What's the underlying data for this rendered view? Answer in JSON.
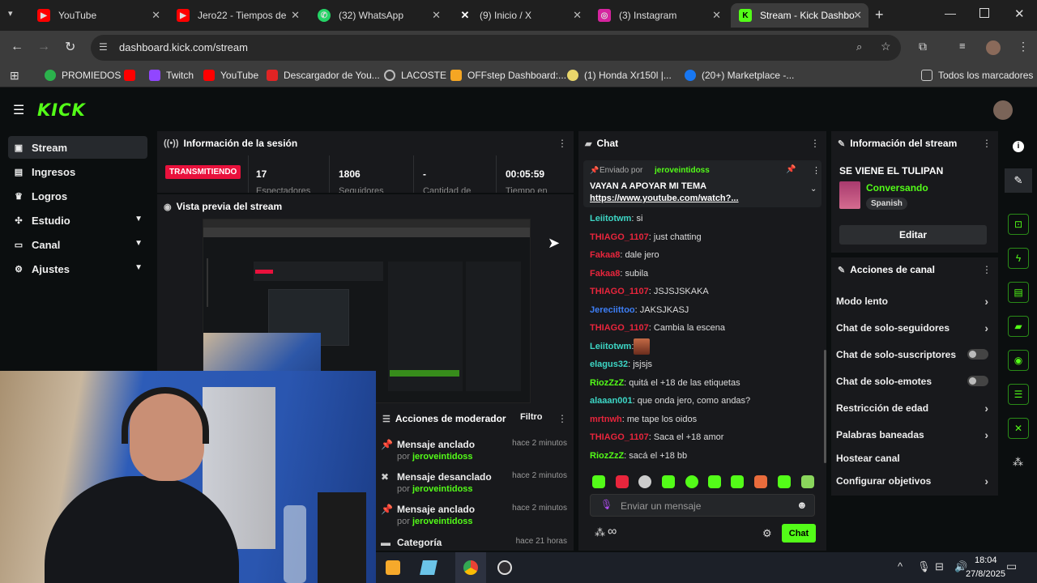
{
  "browser": {
    "tabs": [
      {
        "title": "YouTube",
        "color": "#ff0000"
      },
      {
        "title": "Jero22 - Tiempos de",
        "color": "#ff0000"
      },
      {
        "title": "(32) WhatsApp",
        "color": "#25d366"
      },
      {
        "title": "(9) Inicio / X",
        "color": "#111111"
      },
      {
        "title": "(3) Instagram",
        "color": "#d6249f"
      },
      {
        "title": "Stream - Kick Dashbo",
        "color": "#53fc18"
      }
    ],
    "url": "dashboard.kick.com/stream",
    "bookmarks": [
      {
        "label": "PROMIEDOS",
        "color": "#2bb24c"
      },
      {
        "label": "",
        "color": "#ff0000"
      },
      {
        "label": "Twitch",
        "color": "#9146ff"
      },
      {
        "label": "YouTube",
        "color": "#ff0000"
      },
      {
        "label": "Descargador de You...",
        "color": "#e02424"
      },
      {
        "label": "LACOSTE",
        "color": "#888888"
      },
      {
        "label": "OFFstep Dashboard:...",
        "color": "#f5a623"
      },
      {
        "label": "(1) Honda Xr150l |...",
        "color": "#e9d66b"
      },
      {
        "label": "(20+) Marketplace -...",
        "color": "#1877f2"
      }
    ],
    "all_bookmarks": "Todos los marcadores"
  },
  "kick": {
    "logo": "KICK",
    "sidebar": [
      "Stream",
      "Ingresos",
      "Logros",
      "Estudio",
      "Canal",
      "Ajustes"
    ],
    "session": {
      "title": "Información de la sesión",
      "status": "TRANSMITIENDO",
      "stats": [
        {
          "value": "17",
          "label": "Espectadores"
        },
        {
          "value": "1806",
          "label": "Seguidores"
        },
        {
          "value": "-",
          "label": "Cantidad de"
        },
        {
          "value": "00:05:59",
          "label": "Tiempo en"
        }
      ]
    },
    "preview_title": "Vista previa del stream",
    "moderator": {
      "title": "Acciones de moderador",
      "filter": "Filtro",
      "items": [
        {
          "action": "Mensaje anclado",
          "by": "jeroveintidoss",
          "time": "hace 2 minutos"
        },
        {
          "action": "Mensaje desanclado",
          "by": "jeroveintidoss",
          "time": "hace 2 minutos"
        },
        {
          "action": "Mensaje anclado",
          "by": "jeroveintidoss",
          "time": "hace 2 minutos"
        },
        {
          "action": "Categoría",
          "by": "",
          "time": "hace 21 horas"
        }
      ],
      "by_prefix": "por"
    },
    "chat": {
      "title": "Chat",
      "pinned": {
        "prefix": "Enviado por",
        "user": "jeroveintidoss",
        "text": "VAYAN A APOYAR MI TEMA",
        "link": "https://www.youtube.com/watch?..."
      },
      "messages": [
        {
          "user": "Leiitotwm",
          "color": "#3dd6c5",
          "text": "si"
        },
        {
          "user": "THIAGO_1107",
          "color": "#e8253c",
          "text": "just chatting"
        },
        {
          "user": "Fakaa8",
          "color": "#e8253c",
          "text": "dale jero"
        },
        {
          "user": "Fakaa8",
          "color": "#e8253c",
          "text": "subila"
        },
        {
          "user": "THIAGO_1107",
          "color": "#e8253c",
          "text": "JSJSJSKAKA"
        },
        {
          "user": "Jereciittoo",
          "color": "#3d7ef5",
          "text": "JAKSJKASJ"
        },
        {
          "user": "THIAGO_1107",
          "color": "#e8253c",
          "text": "Cambia la escena"
        },
        {
          "user": "Leiitotwm",
          "color": "#3dd6c5",
          "text": ""
        },
        {
          "user": "elagus32",
          "color": "#3dd6c5",
          "text": "jsjsjs"
        },
        {
          "user": "RiozZzZ",
          "color": "#53fc18",
          "text": "quitá el +18 de las etiquetas"
        },
        {
          "user": "alaaan001",
          "color": "#3dd6c5",
          "text": "que onda jero, como andas?"
        },
        {
          "user": "mrtnwh",
          "color": "#e8253c",
          "text": "me tape los oidos"
        },
        {
          "user": "THIAGO_1107",
          "color": "#e8253c",
          "text": "Saca el +18 amor"
        },
        {
          "user": "RiozZzZ",
          "color": "#53fc18",
          "text": "sacá el +18 bb"
        }
      ],
      "placeholder": "Enviar un mensaje",
      "send": "Chat",
      "infinity": "∞"
    },
    "stream_info": {
      "title": "Información del stream",
      "stream_title": "SE VIENE EL TULIPAN",
      "category": "Conversando",
      "language": "Spanish",
      "edit": "Editar"
    },
    "channel_actions": {
      "title": "Acciones de canal",
      "items": [
        {
          "label": "Modo lento",
          "kind": "arrow"
        },
        {
          "label": "Chat de solo-seguidores",
          "kind": "arrow"
        },
        {
          "label": "Chat de solo-suscriptores",
          "kind": "toggle"
        },
        {
          "label": "Chat de solo-emotes",
          "kind": "toggle"
        },
        {
          "label": "Restricción de edad",
          "kind": "arrow"
        },
        {
          "label": "Palabras baneadas",
          "kind": "arrow"
        },
        {
          "label": "Hostear canal",
          "kind": "none"
        },
        {
          "label": "Configurar objetivos",
          "kind": "arrow"
        }
      ]
    }
  },
  "taskbar": {
    "time": "18:04",
    "date": "27/8/2025"
  }
}
